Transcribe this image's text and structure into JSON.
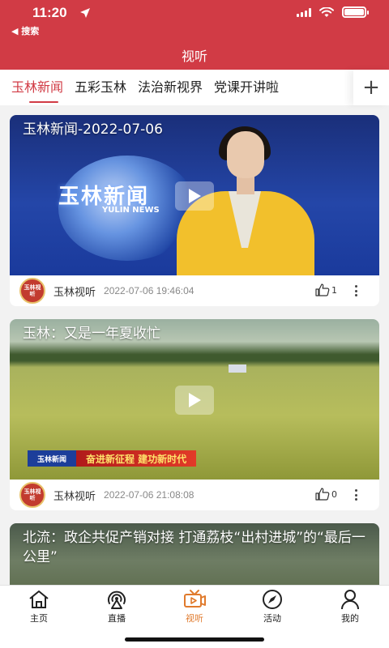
{
  "status_bar": {
    "time": "11:20",
    "back_app": "◀ 搜索"
  },
  "header": {
    "title": "视听"
  },
  "tabs": {
    "items": [
      {
        "label": "玉林新闻",
        "active": true
      },
      {
        "label": "五彩玉林",
        "active": false
      },
      {
        "label": "法治新视界",
        "active": false
      },
      {
        "label": "党课开讲啦",
        "active": false
      }
    ],
    "add_label": "+"
  },
  "feed": {
    "items": [
      {
        "title": "玉林新闻-2022-07-06",
        "thumb_logo": "玉林新闻",
        "thumb_logo_en": "YULIN NEWS",
        "avatar_text": "玉林视听",
        "source": "玉林视听",
        "time": "2022-07-06 19:46:04",
        "likes": "1"
      },
      {
        "title": "玉林：又是一年夏收忙",
        "caption_logo": "玉林新闻",
        "caption_text": "奋进新征程  建功新时代",
        "avatar_text": "玉林视听",
        "source": "玉林视听",
        "time": "2022-07-06 21:08:08",
        "likes": "0"
      },
      {
        "title": "北流：政企共促产销对接 打通荔枝“出村进城”的“最后一公里”"
      }
    ]
  },
  "bottom_nav": {
    "items": [
      {
        "label": "主页",
        "icon": "home-icon"
      },
      {
        "label": "直播",
        "icon": "live-broadcast-icon"
      },
      {
        "label": "视听",
        "icon": "tv-icon",
        "active": true
      },
      {
        "label": "活动",
        "icon": "compass-icon"
      },
      {
        "label": "我的",
        "icon": "user-icon"
      }
    ]
  },
  "colors": {
    "brand_red": "#d13b45",
    "active_orange": "#e07a2c"
  }
}
